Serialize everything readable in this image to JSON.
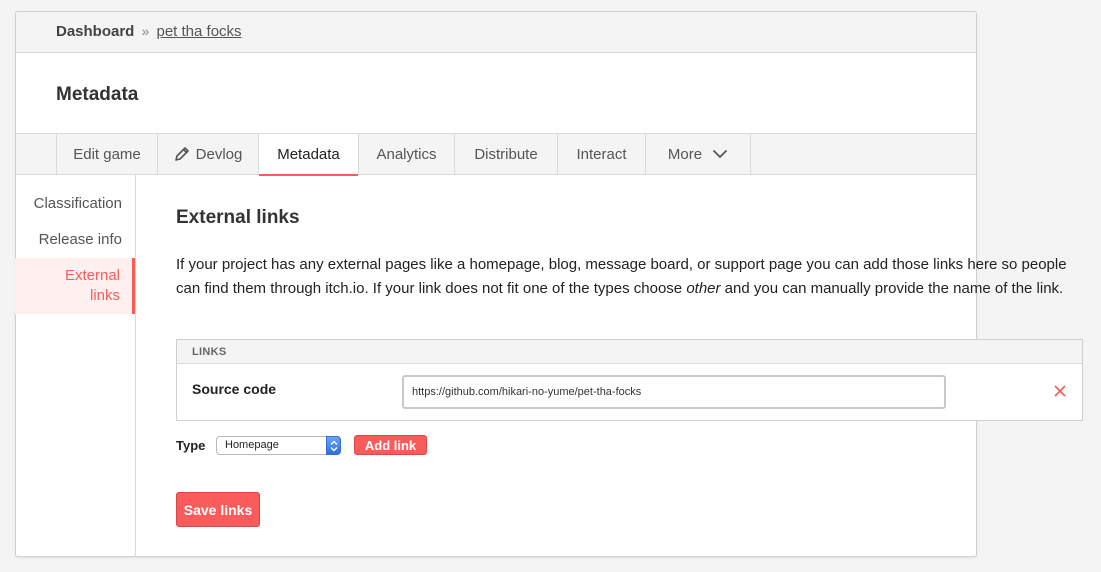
{
  "breadcrumb": {
    "home": "Dashboard",
    "separator": "»",
    "game": "pet tha focks"
  },
  "header": {
    "title": "Metadata"
  },
  "tabs": [
    {
      "label": "Edit game",
      "icon": ""
    },
    {
      "label": "Devlog",
      "icon": "pencil-icon"
    },
    {
      "label": "Metadata",
      "icon": "",
      "active": true
    },
    {
      "label": "Analytics",
      "icon": ""
    },
    {
      "label": "Distribute",
      "icon": ""
    },
    {
      "label": "Interact",
      "icon": ""
    },
    {
      "label": "More",
      "icon": "chevron-down-icon"
    }
  ],
  "sidebar": {
    "items": [
      {
        "label": "Classification"
      },
      {
        "label": "Release info"
      },
      {
        "label_line1": "External",
        "label_line2": "links",
        "active": true
      }
    ]
  },
  "section": {
    "title": "External links",
    "desc_before": "If your project has any external pages like a homepage, blog, message board, or support page you can add those links here so people can find them through itch.io. If your link does not fit one of the types choose ",
    "desc_em": "other",
    "desc_after": " and you can manually provide the name of the link."
  },
  "links": {
    "header": "LINKS",
    "rows": [
      {
        "type": "Source code",
        "url": "https://github.com/hikari-no-yume/pet-tha-focks"
      }
    ]
  },
  "new_link": {
    "type_label": "Type",
    "selected": "Homepage",
    "add_label": "Add link"
  },
  "save_label": "Save links",
  "colors": {
    "accent": "#fa5c5c",
    "tab_bar": "#f4f4f4",
    "active_bg": "#fff0f0"
  }
}
